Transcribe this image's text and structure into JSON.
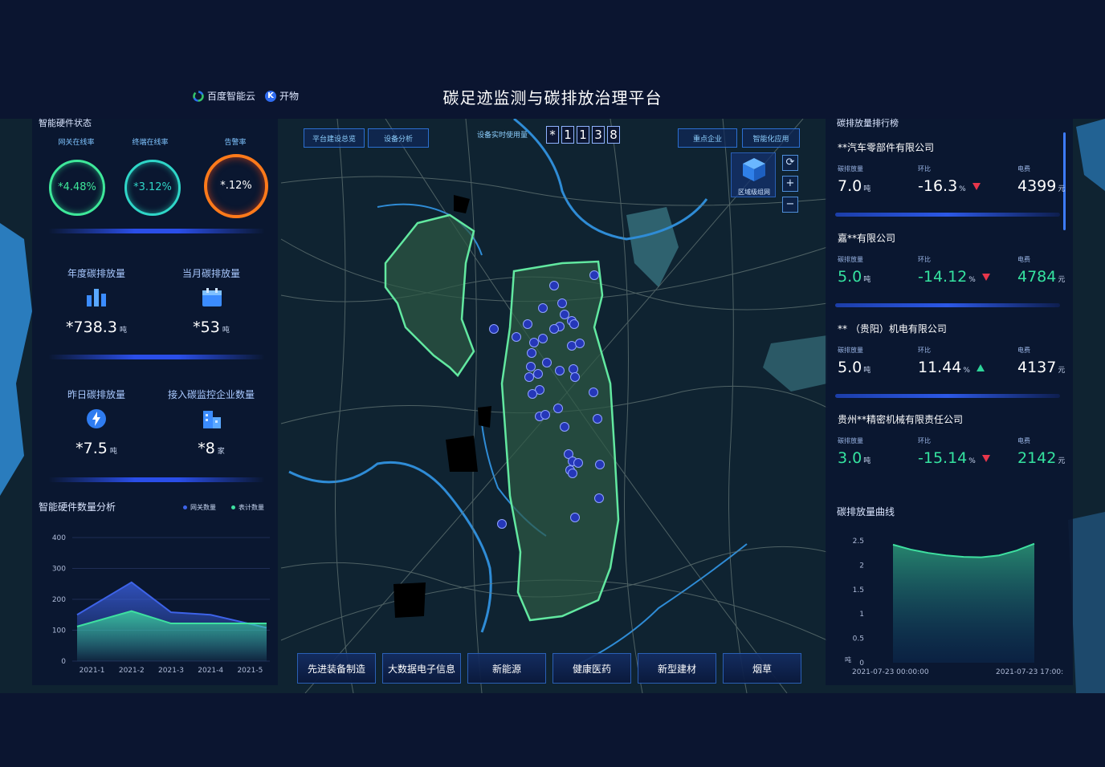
{
  "header": {
    "title": "碳足迹监测与碳排放治理平台",
    "logo_baidu": "百度智能云",
    "logo_kaiwu": "开物"
  },
  "left": {
    "hardware_status_title": "智能硬件状态",
    "gauges": [
      {
        "label": "网关在线率",
        "value": "*4.48%",
        "color": "#3ee89a"
      },
      {
        "label": "终端在线率",
        "value": "*3.12%",
        "color": "#2fd6c8"
      },
      {
        "label": "告警率",
        "value": "*.12%",
        "color": "#ff7a1a"
      }
    ],
    "stats": [
      {
        "label": "年度碳排放量",
        "value": "*738.3",
        "unit": "吨",
        "icon": "bar-chart-icon"
      },
      {
        "label": "当月碳排放量",
        "value": "*53",
        "unit": "吨",
        "icon": "calendar-icon"
      },
      {
        "label": "昨日碳排放量",
        "value": "*7.5",
        "unit": "吨",
        "icon": "lightning-icon"
      },
      {
        "label": "接入碳监控企业数量",
        "value": "*8",
        "unit": "家",
        "icon": "building-icon"
      }
    ],
    "hardware_chart_title": "智能硬件数量分析",
    "legend_gateway": "网关数量",
    "legend_meter": "表计数量"
  },
  "map": {
    "buttons": [
      "平台建设总览",
      "设备分析",
      "重点企业",
      "智能化应用"
    ],
    "device_usage_label": "设备实时使用量",
    "device_digits": [
      "*",
      "1",
      "1",
      "3",
      "8"
    ],
    "region_label": "区域级组网",
    "industries": [
      "先进装备制造",
      "大数据电子信息",
      "新能源",
      "健康医药",
      "新型建材",
      "烟草"
    ]
  },
  "right": {
    "ranking_title": "碳排放量排行榜",
    "col_labels": {
      "emission": "碳排放量",
      "ratio": "环比",
      "power": "电费"
    },
    "companies": [
      {
        "name": "**汽车零部件有限公司",
        "emission": "7.0",
        "emission_unit": "吨",
        "ratio": "-16.3",
        "ratio_unit": "%",
        "trend": "down",
        "power": "4399",
        "power_unit": "元",
        "highlight": false
      },
      {
        "name": "嘉**有限公司",
        "emission": "5.0",
        "emission_unit": "吨",
        "ratio": "-14.12",
        "ratio_unit": "%",
        "trend": "down",
        "power": "4784",
        "power_unit": "元",
        "highlight": true
      },
      {
        "name": "** （贵阳）机电有限公司",
        "emission": "5.0",
        "emission_unit": "吨",
        "ratio": "11.44",
        "ratio_unit": "%",
        "trend": "up",
        "power": "4137",
        "power_unit": "元",
        "highlight": false
      },
      {
        "name": "贵州**精密机械有限责任公司",
        "emission": "3.0",
        "emission_unit": "吨",
        "ratio": "-15.14",
        "ratio_unit": "%",
        "trend": "down",
        "power": "2142",
        "power_unit": "元",
        "highlight": true
      }
    ],
    "curve_title": "碳排放量曲线"
  },
  "chart_data": [
    {
      "type": "area",
      "title": "智能硬件数量分析",
      "categories": [
        "2021-1",
        "2021-2",
        "2021-3",
        "2021-4",
        "2021-5"
      ],
      "ylim": [
        0,
        400
      ],
      "yticks": [
        0,
        100,
        200,
        300,
        400
      ],
      "series": [
        {
          "name": "网关数量",
          "values": [
            150,
            255,
            158,
            150,
            108
          ],
          "color": "#3d63e8"
        },
        {
          "name": "表计数量",
          "values": [
            112,
            162,
            122,
            122,
            122
          ],
          "color": "#3ee0a0"
        }
      ]
    },
    {
      "type": "area",
      "title": "碳排放量曲线",
      "ylabel": "吨",
      "x_start_label": "2021-07-23 00:00:00",
      "x_end_label": "2021-07-23 17:00:",
      "ylim": [
        0,
        2.5
      ],
      "yticks": [
        "0",
        "0.5",
        "1",
        "1.5",
        "2",
        "2.5"
      ],
      "x": [
        0,
        1,
        2,
        3,
        4,
        5,
        6,
        7,
        8
      ],
      "values": [
        2.42,
        2.32,
        2.25,
        2.2,
        2.17,
        2.16,
        2.2,
        2.3,
        2.44
      ],
      "color": "#3ee0a0"
    }
  ]
}
